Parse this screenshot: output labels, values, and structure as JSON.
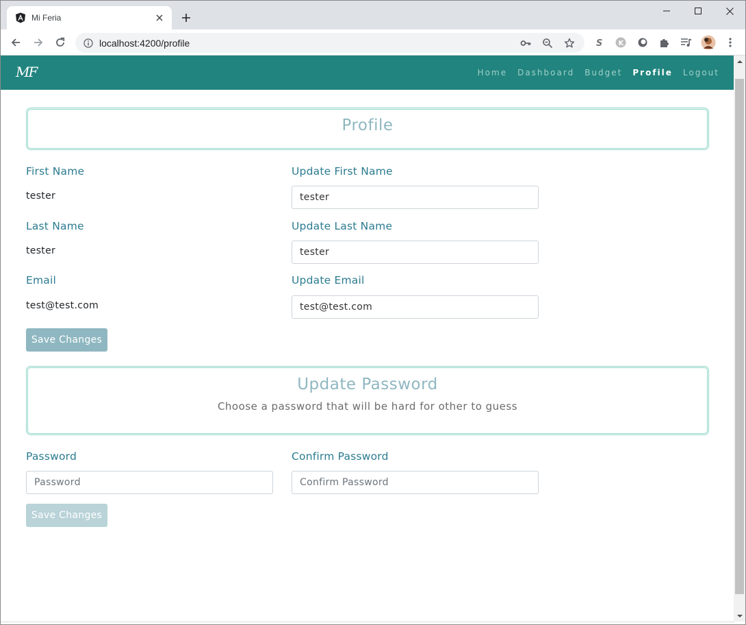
{
  "browser": {
    "tab_title": "Mi Feria",
    "url": "localhost:4200/profile"
  },
  "app": {
    "brand": "MF",
    "nav": [
      "Home",
      "Dashboard",
      "Budget",
      "Profile",
      "Logout"
    ],
    "active_nav": "Profile",
    "colors": {
      "navbar": "#22847e",
      "accent_text": "#2b7b90",
      "header_title": "#8fb7c1",
      "button": "#8fb7c1",
      "button_disabled": "#b9d3d8",
      "box_border": "#8fd5c7"
    }
  },
  "profile": {
    "title": "Profile",
    "first_name": {
      "label": "First Name",
      "value": "tester"
    },
    "last_name": {
      "label": "Last Name",
      "value": "tester"
    },
    "email": {
      "label": "Email",
      "value": "test@test.com"
    },
    "update_first_name": {
      "label": "Update First Name",
      "value": "tester"
    },
    "update_last_name": {
      "label": "Update Last Name",
      "value": "tester"
    },
    "update_email": {
      "label": "Update Email",
      "value": "test@test.com"
    },
    "save_label": "Save Changes"
  },
  "password": {
    "title": "Update Password",
    "subtitle": "Choose a password that will be hard for other to guess",
    "password": {
      "label": "Password",
      "placeholder": "Password"
    },
    "confirm": {
      "label": "Confirm Password",
      "placeholder": "Confirm Password"
    },
    "save_label": "Save Changes"
  }
}
